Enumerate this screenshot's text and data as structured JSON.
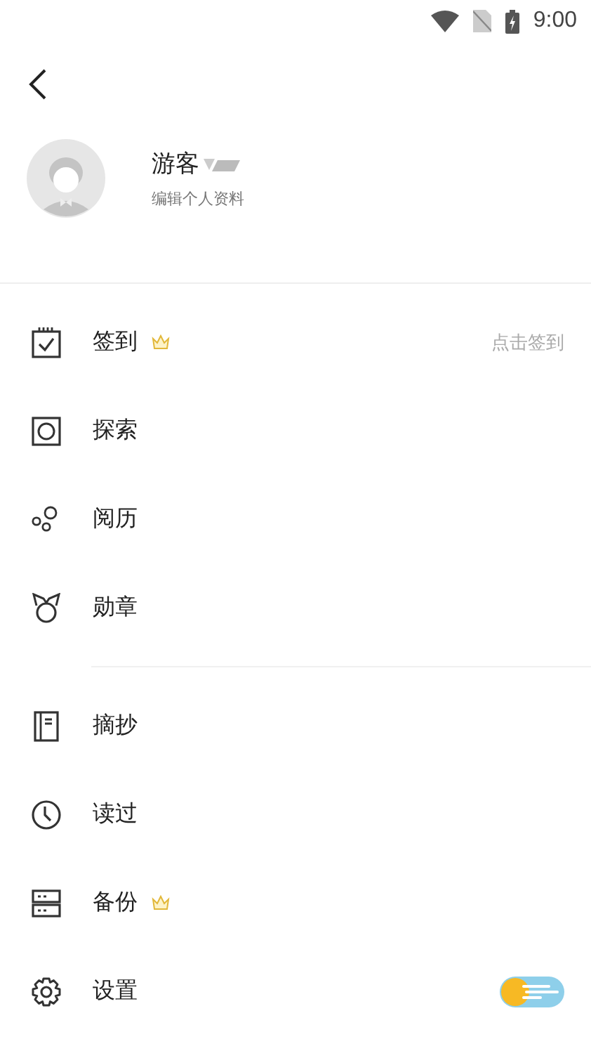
{
  "status_bar": {
    "time": "9:00"
  },
  "profile": {
    "name": "游客",
    "subtitle": "编辑个人资料"
  },
  "sections": [
    {
      "items": [
        {
          "label": "签到",
          "vip": true,
          "hint": "点击签到"
        },
        {
          "label": "探索",
          "vip": false
        },
        {
          "label": "阅历",
          "vip": false
        },
        {
          "label": "勋章",
          "vip": false
        }
      ]
    },
    {
      "items": [
        {
          "label": "摘抄",
          "vip": false
        },
        {
          "label": "读过",
          "vip": false
        },
        {
          "label": "备份",
          "vip": true
        },
        {
          "label": "设置",
          "vip": false,
          "night_mode": false
        }
      ]
    }
  ]
}
